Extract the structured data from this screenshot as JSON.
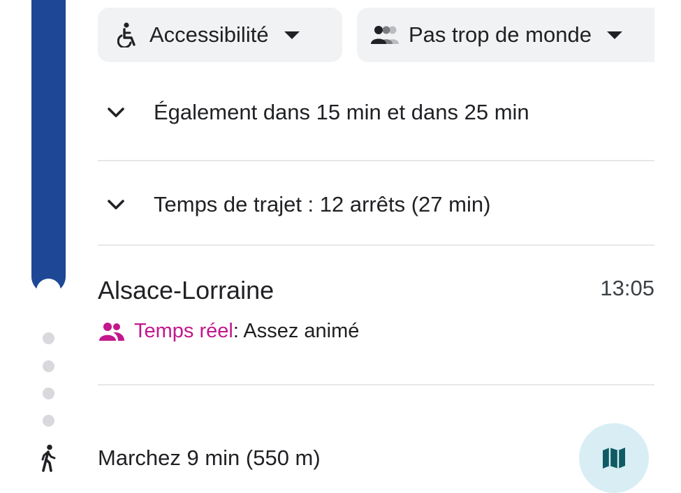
{
  "filters": {
    "accessibility": {
      "label": "Accessibilité",
      "icon": "wheelchair-icon"
    },
    "crowding": {
      "label": "Pas trop de monde",
      "icon": "people-icon"
    }
  },
  "departures": {
    "also_label": "Également dans 15 min et dans 25 min",
    "icon": "chevron-down-icon"
  },
  "trip": {
    "duration_label": "Temps de trajet : 12 arrêts (27 min)",
    "icon": "chevron-down-icon"
  },
  "stop": {
    "name": "Alsace-Lorraine",
    "time": "13:05",
    "realtime_label": "Temps réel",
    "realtime_separator": ":",
    "crowd_status": " Assez animé",
    "realtime_icon": "people-icon"
  },
  "walk": {
    "label": "Marchez 9 min (550 m)",
    "icon": "walking-person-icon",
    "map_button_icon": "map-icon"
  },
  "colors": {
    "line": "#1e4796",
    "realtime": "#c2188c",
    "map_button_bg": "#d8eef4",
    "map_icon": "#0f5b63"
  }
}
